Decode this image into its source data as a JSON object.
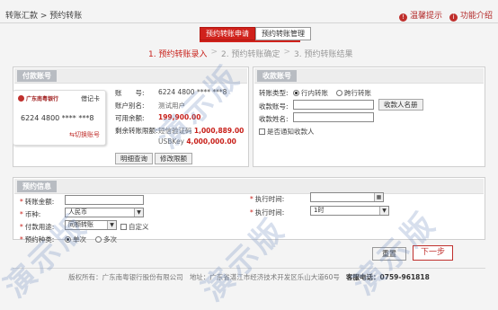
{
  "breadcrumb": "转账汇款 > 预约转账",
  "helpers": {
    "tips": "温馨提示",
    "intro": "功能介绍"
  },
  "tabs": [
    "预约转账申请",
    "预约转账管理"
  ],
  "steps": [
    "1. 预约转账录入",
    "2. 预约转账确定",
    "3. 预约转账结果"
  ],
  "payer": {
    "title": "付款账号",
    "bank_name": "广东南粤银行",
    "card_type": "借记卡",
    "card_no": "6224 4800 **** ***8",
    "switch": "切换账号",
    "rows": [
      {
        "label": "账　　号:",
        "value": "6224 4800 **** ***8"
      },
      {
        "label": "账户别名:",
        "value": "测试用户"
      },
      {
        "label": "可用余额:",
        "value": "199,900.00"
      },
      {
        "label": "剩余转账限额:",
        "value_a_label": "短信验证码",
        "value_a": "1,000,889.00",
        "value_b_label": "USBKey",
        "value_b": "4,000,000.00"
      }
    ],
    "btn_detail": "明细查询",
    "btn_limit": "修改限额"
  },
  "payee": {
    "title": "收款账号",
    "type_label": "转账类型:",
    "type_options": [
      "行内转账",
      "跨行转账"
    ],
    "account_label": "收款账号:",
    "account_value": "",
    "name_label": "收款姓名:",
    "name_value": "",
    "payee_list_btn": "收款人名册",
    "notify_label": "是否通知收款人"
  },
  "appointment": {
    "title": "预约信息",
    "amount_label": "转账金额:",
    "amount_value": "",
    "currency_label": "币种:",
    "currency_value": "人民币",
    "purpose_label": "付款用途:",
    "purpose_value": "同额转账",
    "custom_label": "自定义",
    "kind_label": "预约种类:",
    "kind_options": [
      "单次",
      "多次"
    ],
    "exec_time_label": "执行时间:",
    "exec_time_value": "",
    "exec_time2_label": "执行时间:",
    "exec_time2_value": "1时"
  },
  "actions": {
    "reset": "重置",
    "next": "下一步"
  },
  "footer": {
    "copyright": "版权所有：广东南粤银行股份有限公司",
    "address": "地址：广东省湛江市经济技术开发区乐山大道60号",
    "phone_label": "客服电话：",
    "phone": "0759-961818"
  },
  "watermark": "演示版",
  "colors": {
    "accent": "#d0221c",
    "panel_title": "#b8bcc2"
  }
}
